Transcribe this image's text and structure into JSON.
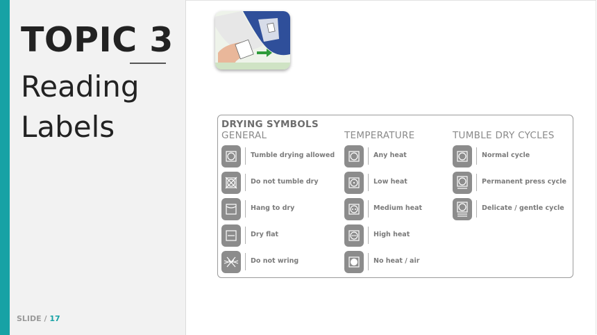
{
  "slide": {
    "topic_word": "TOPIC",
    "topic_number": "3",
    "subtitle_line1": "Reading",
    "subtitle_line2": "Labels",
    "footer_label": "SLIDE /",
    "footer_number": "17"
  },
  "colors": {
    "accent": "#17a2a5",
    "panel": "#f2f2f2",
    "icon_bg": "#8c8c8c"
  },
  "chart": {
    "title": "DRYING SYMBOLS",
    "columns": [
      {
        "heading": "GENERAL",
        "items": [
          {
            "icon": "tumble-dry-allowed-icon",
            "label": "Tumble drying allowed"
          },
          {
            "icon": "do-not-tumble-dry-icon",
            "label": "Do not tumble dry"
          },
          {
            "icon": "hang-to-dry-icon",
            "label": "Hang to dry"
          },
          {
            "icon": "dry-flat-icon",
            "label": "Dry flat"
          },
          {
            "icon": "do-not-wring-icon",
            "label": "Do not wring"
          }
        ]
      },
      {
        "heading": "TEMPERATURE",
        "items": [
          {
            "icon": "any-heat-icon",
            "label": "Any heat"
          },
          {
            "icon": "low-heat-icon",
            "label": "Low heat"
          },
          {
            "icon": "medium-heat-icon",
            "label": "Medium heat"
          },
          {
            "icon": "high-heat-icon",
            "label": "High heat"
          },
          {
            "icon": "no-heat-icon",
            "label": "No heat / air"
          }
        ]
      },
      {
        "heading": "TUMBLE DRY CYCLES",
        "items": [
          {
            "icon": "normal-cycle-icon",
            "label": "Normal cycle"
          },
          {
            "icon": "permanent-press-icon",
            "label": "Permanent press cycle"
          },
          {
            "icon": "delicate-cycle-icon",
            "label": "Delicate / gentle cycle"
          }
        ]
      }
    ]
  }
}
